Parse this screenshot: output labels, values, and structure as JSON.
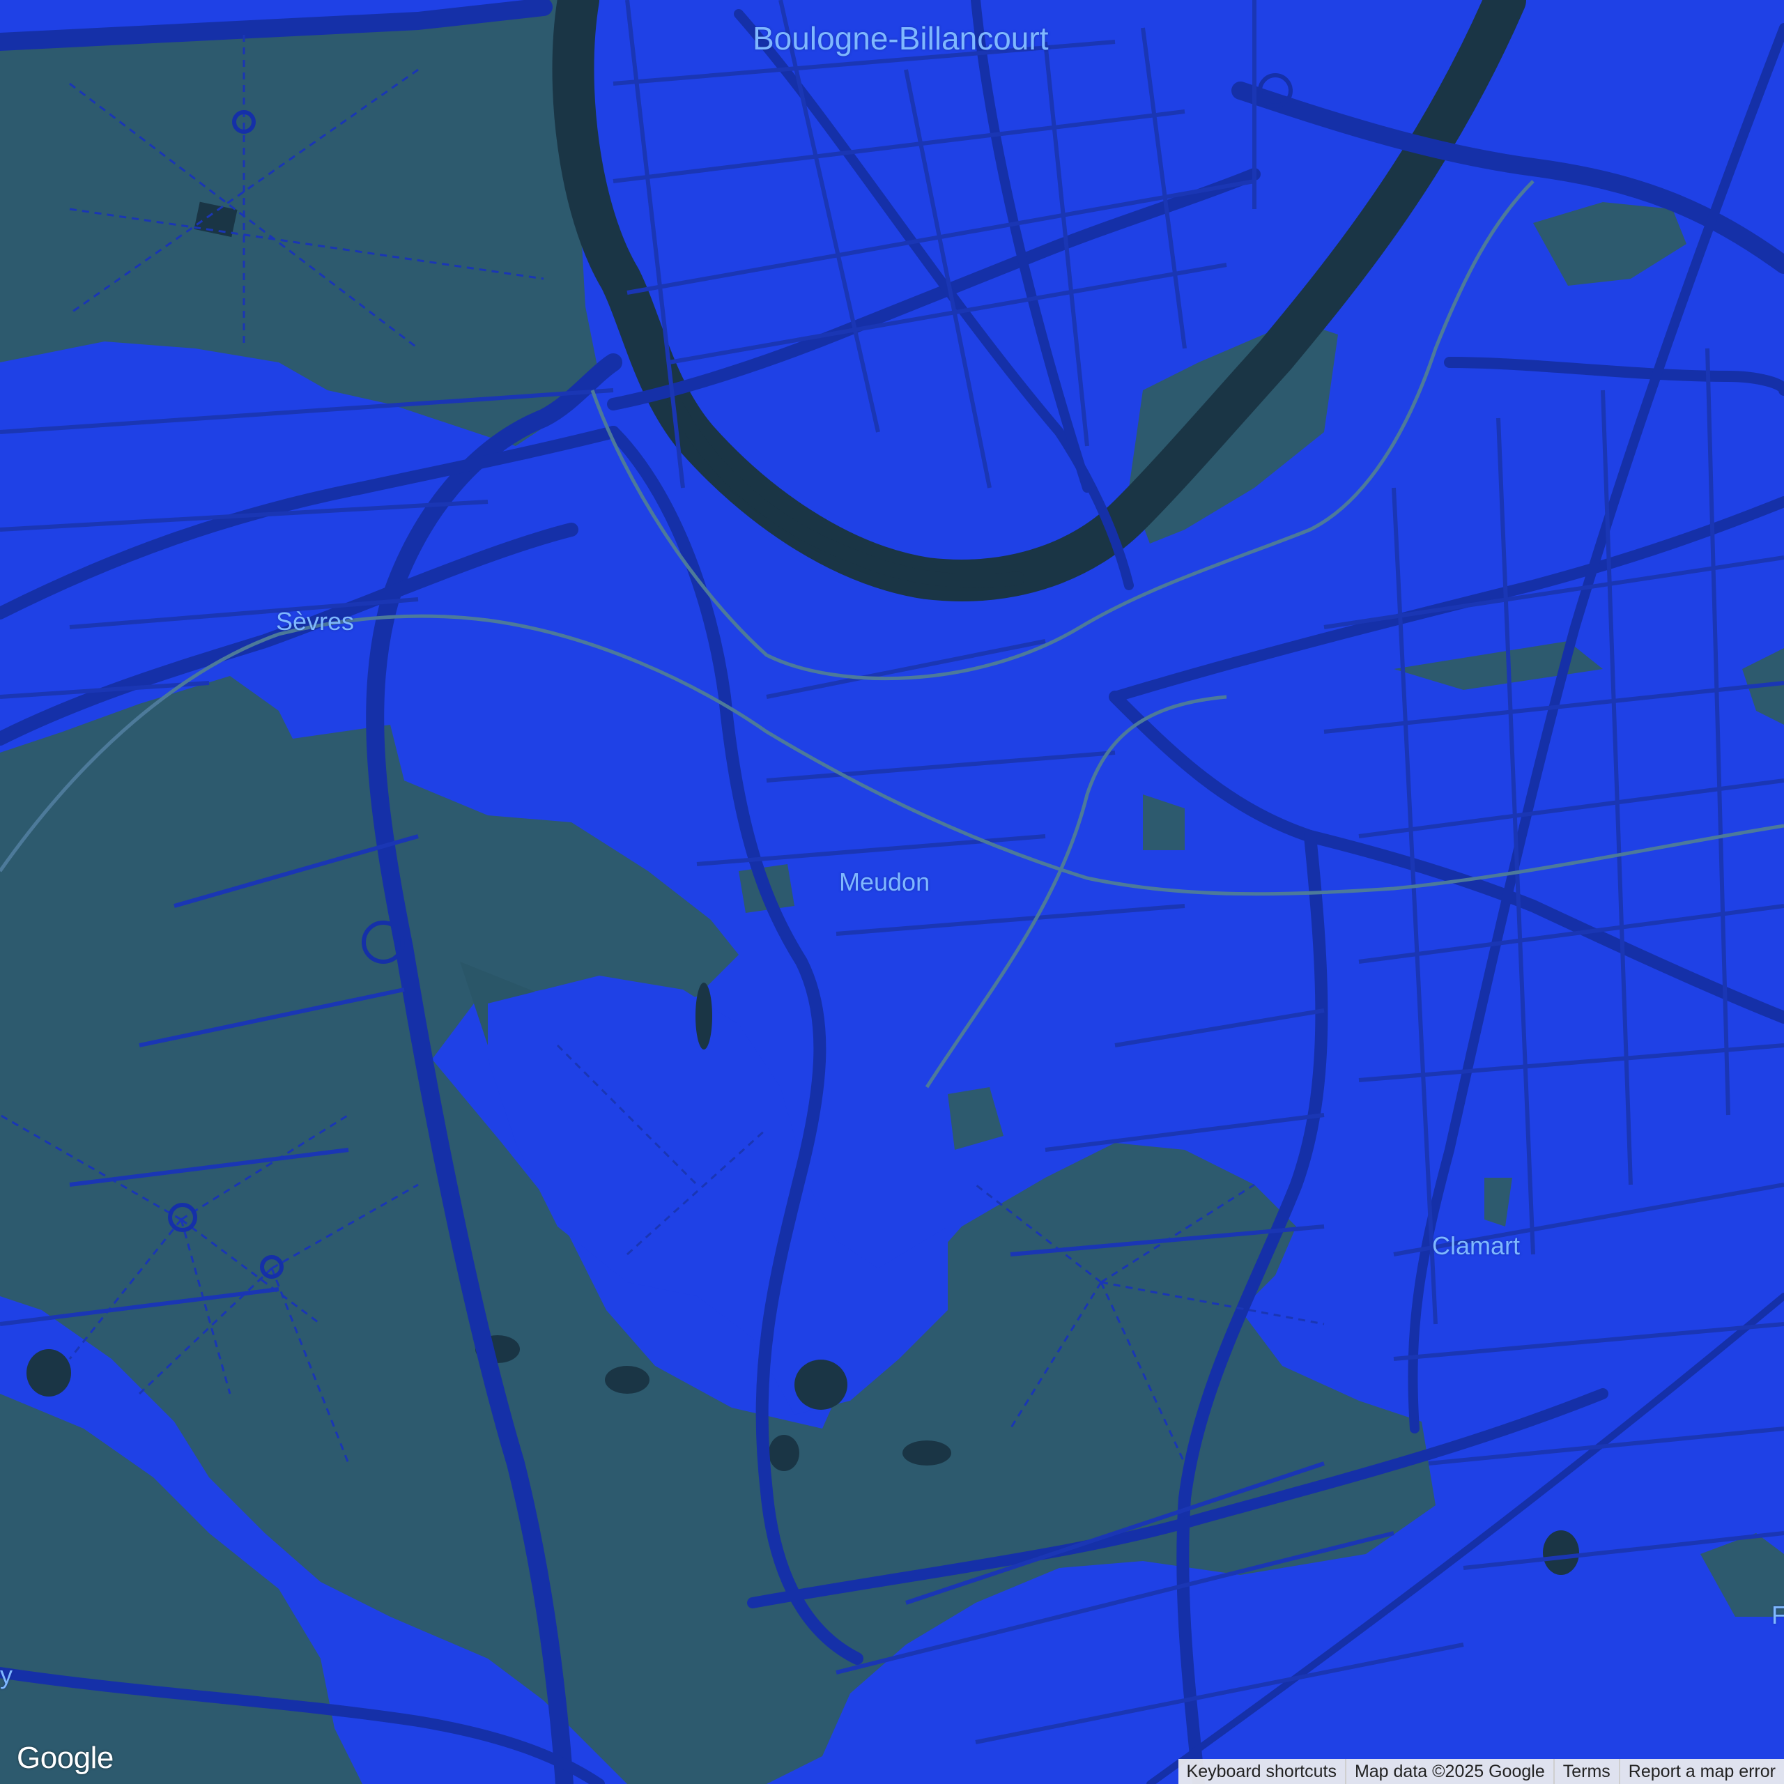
{
  "map": {
    "colors": {
      "urban": "#1f41e6",
      "park": "#2d5a6e",
      "water": "#1a3545",
      "road_major": "#1530a8",
      "road_minor": "#1a3ab8",
      "rail": "#4d7a9a",
      "label": "#7fb8ff"
    },
    "labels": {
      "boulogne": "Boulogne-Billancourt",
      "sevres": "Sèvres",
      "meudon": "Meudon",
      "clamart": "Clamart",
      "edge_left": "y",
      "edge_right": "F"
    }
  },
  "footer": {
    "logo": "Google",
    "keyboard_shortcuts": "Keyboard shortcuts",
    "map_data": "Map data ©2025 Google",
    "terms": "Terms",
    "report": "Report a map error"
  }
}
